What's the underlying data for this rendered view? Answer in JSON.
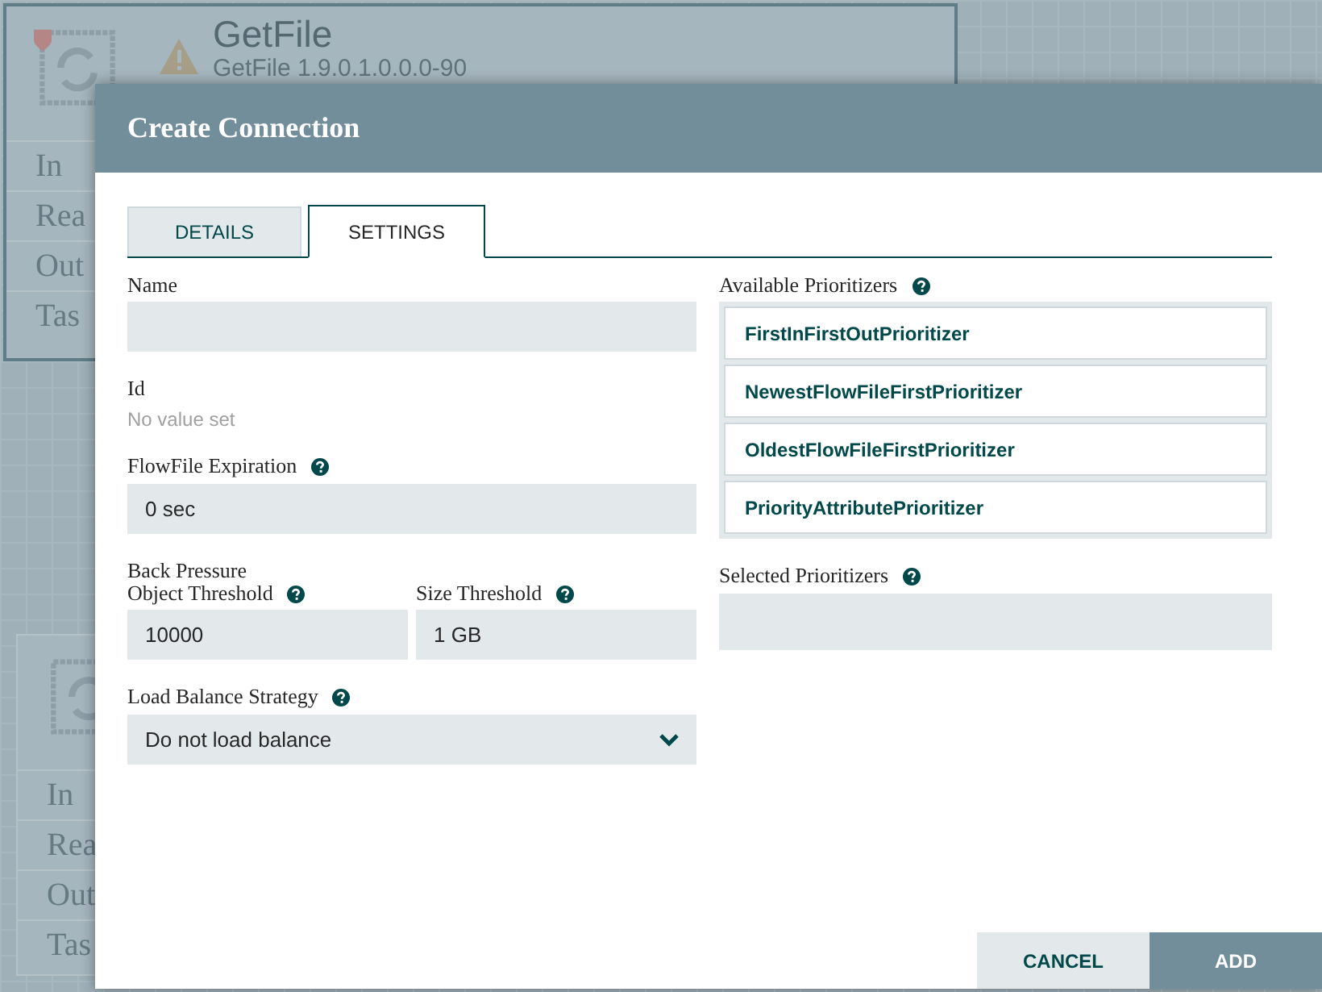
{
  "canvas": {
    "processors": [
      {
        "name": "GetFile",
        "type": "GetFile 1.9.0.1.0.0.0-90",
        "warning": true,
        "stats": [
          "In",
          "Rea",
          "Out",
          "Tas"
        ]
      },
      {
        "stats": [
          "In",
          "Rea",
          "Out",
          "Tas"
        ]
      }
    ]
  },
  "dialog": {
    "title": "Create Connection",
    "tabs": [
      {
        "label": "DETAILS",
        "selected": false
      },
      {
        "label": "SETTINGS",
        "selected": true
      }
    ],
    "name": {
      "label": "Name"
    },
    "id": {
      "label": "Id",
      "value": "No value set"
    },
    "expiration": {
      "label": "FlowFile Expiration",
      "value": "0 sec"
    },
    "back_pressure": {
      "label": "Back Pressure",
      "object_threshold": {
        "label": "Object Threshold",
        "value": "10000"
      },
      "size_threshold": {
        "label": "Size Threshold",
        "value": "1 GB"
      }
    },
    "load_balance": {
      "label": "Load Balance Strategy",
      "value": "Do not load balance"
    },
    "available_prioritizers": {
      "label": "Available Prioritizers",
      "items": [
        "FirstInFirstOutPrioritizer",
        "NewestFlowFileFirstPrioritizer",
        "OldestFlowFileFirstPrioritizer",
        "PriorityAttributePrioritizer"
      ]
    },
    "selected_prioritizers": {
      "label": "Selected Prioritizers"
    },
    "buttons": [
      {
        "label": "CANCEL",
        "kind": "secondary"
      },
      {
        "label": "ADD",
        "kind": "primary"
      }
    ]
  }
}
